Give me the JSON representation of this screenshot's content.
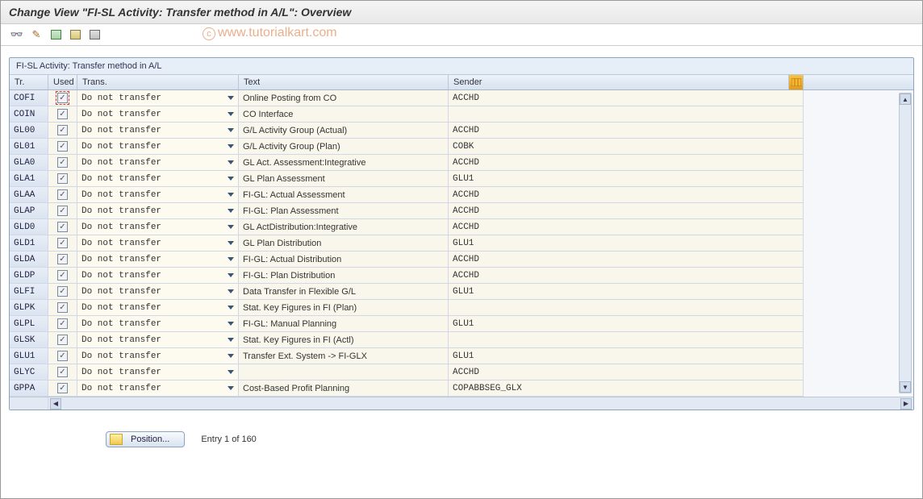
{
  "title": "Change View \"FI-SL Activity: Transfer method in A/L\": Overview",
  "watermark": "www.tutorialkart.com",
  "panel_title": "FI-SL Activity: Transfer method in A/L",
  "headers": {
    "tr": "Tr.",
    "used": "Used",
    "trans": "Trans.",
    "text": "Text",
    "sender": "Sender"
  },
  "rows": [
    {
      "tr": "COFI",
      "used": true,
      "trans": "Do not transfer",
      "text": "Online Posting from CO",
      "sender": "ACCHD"
    },
    {
      "tr": "COIN",
      "used": true,
      "trans": "Do not transfer",
      "text": "CO Interface",
      "sender": ""
    },
    {
      "tr": "GL00",
      "used": true,
      "trans": "Do not transfer",
      "text": "G/L Activity Group (Actual)",
      "sender": "ACCHD"
    },
    {
      "tr": "GL01",
      "used": true,
      "trans": "Do not transfer",
      "text": "G/L Activity Group (Plan)",
      "sender": "COBK"
    },
    {
      "tr": "GLA0",
      "used": true,
      "trans": "Do not transfer",
      "text": "GL Act. Assessment:Integrative",
      "sender": "ACCHD"
    },
    {
      "tr": "GLA1",
      "used": true,
      "trans": "Do not transfer",
      "text": "GL Plan Assessment",
      "sender": "GLU1"
    },
    {
      "tr": "GLAA",
      "used": true,
      "trans": "Do not transfer",
      "text": "FI-GL: Actual Assessment",
      "sender": "ACCHD"
    },
    {
      "tr": "GLAP",
      "used": true,
      "trans": "Do not transfer",
      "text": "FI-GL: Plan Assessment",
      "sender": "ACCHD"
    },
    {
      "tr": "GLD0",
      "used": true,
      "trans": "Do not transfer",
      "text": "GL ActDistribution:Integrative",
      "sender": "ACCHD"
    },
    {
      "tr": "GLD1",
      "used": true,
      "trans": "Do not transfer",
      "text": "GL Plan Distribution",
      "sender": "GLU1"
    },
    {
      "tr": "GLDA",
      "used": true,
      "trans": "Do not transfer",
      "text": "FI-GL: Actual Distribution",
      "sender": "ACCHD"
    },
    {
      "tr": "GLDP",
      "used": true,
      "trans": "Do not transfer",
      "text": "FI-GL: Plan Distribution",
      "sender": "ACCHD"
    },
    {
      "tr": "GLFI",
      "used": true,
      "trans": "Do not transfer",
      "text": "Data Transfer in Flexible G/L",
      "sender": "GLU1"
    },
    {
      "tr": "GLPK",
      "used": true,
      "trans": "Do not transfer",
      "text": "Stat. Key Figures in FI (Plan)",
      "sender": ""
    },
    {
      "tr": "GLPL",
      "used": true,
      "trans": "Do not transfer",
      "text": "FI-GL: Manual Planning",
      "sender": "GLU1"
    },
    {
      "tr": "GLSK",
      "used": true,
      "trans": "Do not transfer",
      "text": "Stat. Key Figures in FI (Actl)",
      "sender": ""
    },
    {
      "tr": "GLU1",
      "used": true,
      "trans": "Do not transfer",
      "text": "Transfer Ext. System -> FI-GLX",
      "sender": "GLU1"
    },
    {
      "tr": "GLYC",
      "used": true,
      "trans": "Do not transfer",
      "text": "",
      "sender": "ACCHD"
    },
    {
      "tr": "GPPA",
      "used": true,
      "trans": "Do not transfer",
      "text": "Cost-Based Profit Planning",
      "sender": "COPABBSEG_GLX"
    }
  ],
  "position_button": "Position...",
  "entry_text": "Entry 1 of 160"
}
